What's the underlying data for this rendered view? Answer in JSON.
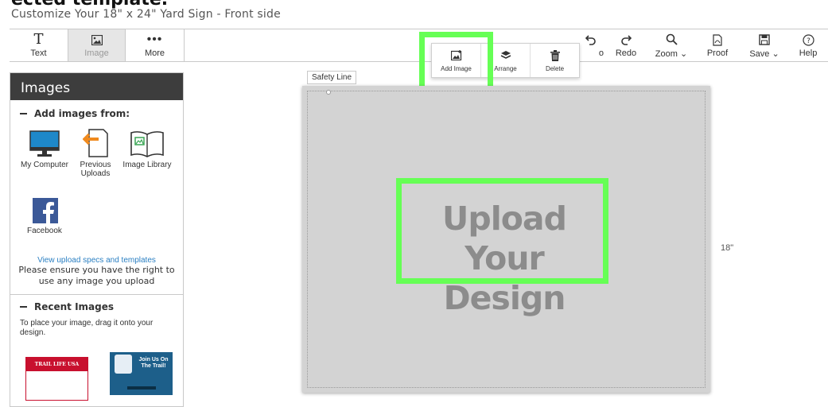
{
  "page": {
    "cut_title": "ected template.",
    "subtitle": "Customize Your 18\" x 24\" Yard Sign - Front side"
  },
  "toolbar": {
    "left": [
      {
        "label": "Text",
        "icon": "text-icon"
      },
      {
        "label": "Image",
        "icon": "image-icon",
        "active": true
      },
      {
        "label": "More",
        "icon": "more-icon"
      }
    ],
    "right": [
      {
        "label": "Undo",
        "icon": "undo-icon"
      },
      {
        "label": "Redo",
        "icon": "redo-icon"
      },
      {
        "label": "Zoom",
        "icon": "zoom-icon"
      },
      {
        "label": "Proof",
        "icon": "proof-icon"
      },
      {
        "label": "Save",
        "icon": "save-icon"
      },
      {
        "label": "Help",
        "icon": "help-icon"
      }
    ],
    "undo_visible": "o"
  },
  "popup": {
    "add_image": "Add Image",
    "arrange": "Arrange",
    "delete": "Delete"
  },
  "panel": {
    "title": "Images",
    "add_from": "Add images from:",
    "sources": [
      {
        "label": "My Computer",
        "icon": "monitor-icon"
      },
      {
        "label": "Previous Uploads",
        "icon": "previous-uploads-icon"
      },
      {
        "label": "Image Library",
        "icon": "library-book-icon"
      },
      {
        "label": "Facebook",
        "icon": "facebook-icon"
      }
    ],
    "specs_link": "View upload specs and templates",
    "rights_note": "Please ensure you have the right to use any image you upload",
    "recent_title": "Recent Images",
    "recent_note": "To place your image, drag it onto your design.",
    "thumb1_text": "TRAIL LIFE USA",
    "thumb2_text": "Join Us On The Trail!"
  },
  "canvas": {
    "safety_label": "Safety Line",
    "upload_text": "Upload Your Design",
    "height_label": "18\""
  },
  "colors": {
    "highlight": "#66ff55",
    "panel_header": "#3d3d3d",
    "link": "#2a7fc2",
    "canvas_bg": "#d3d3d3"
  }
}
